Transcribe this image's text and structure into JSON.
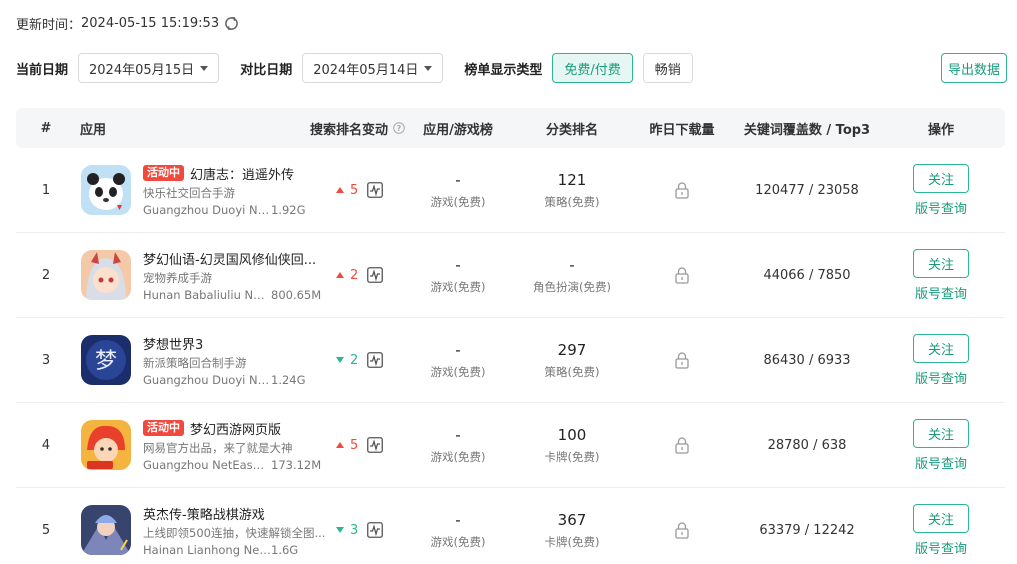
{
  "update": {
    "label": "更新时间：",
    "time": "2024-05-15 15:19:53"
  },
  "filters": {
    "current_date_label": "当前日期",
    "current_date": "2024年05月15日",
    "compare_date_label": "对比日期",
    "compare_date": "2024年05月14日",
    "chart_type_label": "榜单显示类型",
    "chart_types": [
      "免费/付费",
      "畅销"
    ],
    "export_label": "导出数据"
  },
  "table": {
    "headers": {
      "rank": "#",
      "app": "应用",
      "search_change": "搜索排名变动",
      "app_game_chart": "应用/游戏榜",
      "category_rank": "分类排名",
      "downloads": "昨日下载量",
      "keywords": "关键词覆盖数 / Top3",
      "actions": "操作"
    },
    "rows": [
      {
        "rank": "1",
        "badge": "活动中",
        "name": "幻唐志：逍遥外传",
        "subtitle": "快乐社交回合手游",
        "developer": "Guangzhou Duoyi Ne...",
        "size": "1.92G",
        "change_dir": "up",
        "change": "5",
        "chart_rank": "-",
        "chart_type": "游戏(免费)",
        "cat_rank": "121",
        "cat_type": "策略(免费)",
        "keywords": "120477 / 23058"
      },
      {
        "rank": "2",
        "badge": "",
        "name": "梦幻仙语-幻灵国风修仙侠回...",
        "subtitle": "宠物养成手游",
        "developer": "Hunan Babaliuliu Net...",
        "size": "800.65M",
        "change_dir": "up",
        "change": "2",
        "chart_rank": "-",
        "chart_type": "游戏(免费)",
        "cat_rank": "-",
        "cat_type": "角色扮演(免费)",
        "keywords": "44066 / 7850"
      },
      {
        "rank": "3",
        "badge": "",
        "name": "梦想世界3",
        "subtitle": "新派策略回合制手游",
        "developer": "Guangzhou Duoyi Ne...",
        "size": "1.24G",
        "change_dir": "down",
        "change": "2",
        "chart_rank": "-",
        "chart_type": "游戏(免费)",
        "cat_rank": "297",
        "cat_type": "策略(免费)",
        "keywords": "86430 / 6933"
      },
      {
        "rank": "4",
        "badge": "活动中",
        "name": "梦幻西游网页版",
        "subtitle": "网易官方出品，来了就是大神",
        "developer": "Guangzhou NetEase ...",
        "size": "173.12M",
        "change_dir": "up",
        "change": "5",
        "chart_rank": "-",
        "chart_type": "游戏(免费)",
        "cat_rank": "100",
        "cat_type": "卡牌(免费)",
        "keywords": "28780 / 638"
      },
      {
        "rank": "5",
        "badge": "",
        "name": "英杰传-策略战棋游戏",
        "subtitle": "上线即领500连抽，快速解锁全图...",
        "developer": "Hainan Lianhong Net...",
        "size": "1.6G",
        "change_dir": "down",
        "change": "3",
        "chart_rank": "-",
        "chart_type": "游戏(免费)",
        "cat_rank": "367",
        "cat_type": "卡牌(免费)",
        "keywords": "63379 / 12242"
      }
    ],
    "follow_label": "关注",
    "version_label": "版号查询"
  },
  "icon_colors": [
    "#cfe6f7",
    "#e79b9b",
    "#1b2d6b",
    "#f08a2a",
    "#37446e"
  ],
  "accent_color": "#2bb592",
  "up_color": "#f04a3e"
}
